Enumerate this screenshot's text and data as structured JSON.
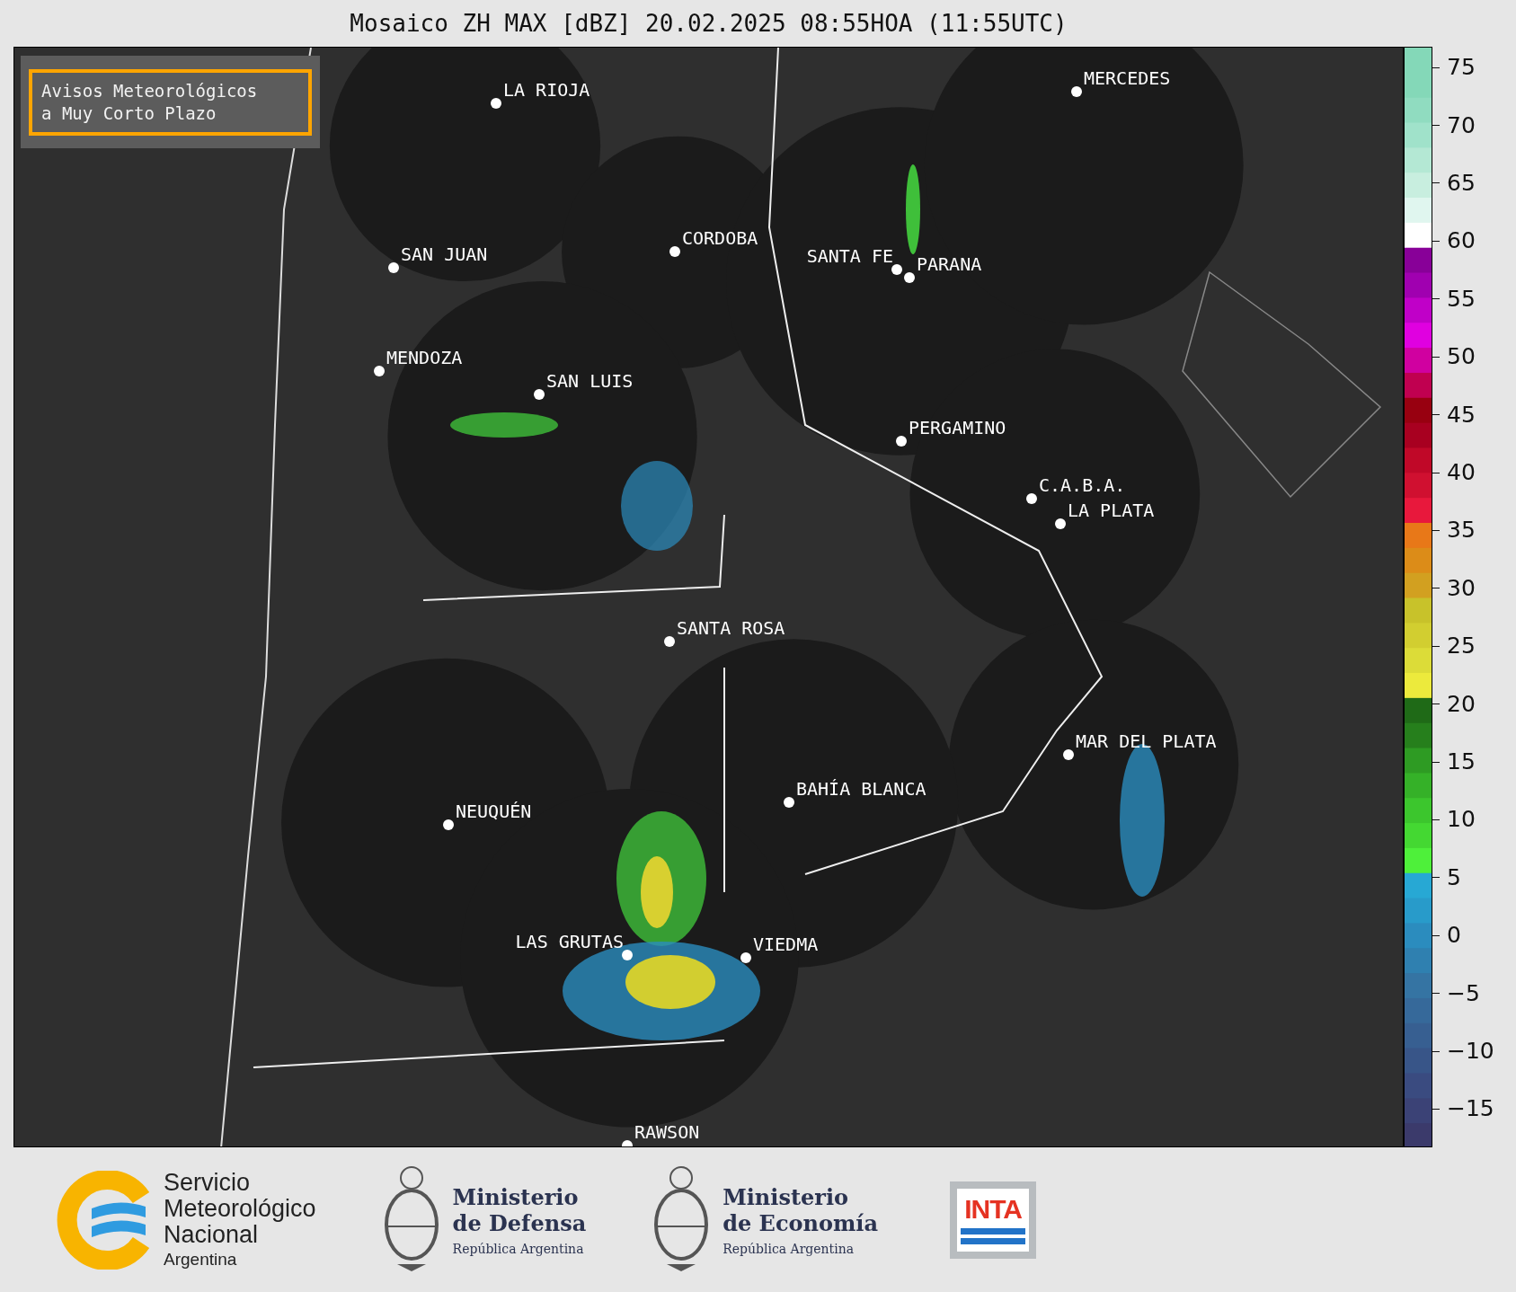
{
  "title": "Mosaico ZH MAX [dBZ] 20.02.2025 08:55HOA (11:55UTC)",
  "legend_box": {
    "lines": [
      "Avisos Meteorológicos",
      "a Muy Corto Plazo"
    ]
  },
  "cities": [
    {
      "name": "LA RIOJA"
    },
    {
      "name": "SAN JUAN"
    },
    {
      "name": "CORDOBA"
    },
    {
      "name": "SANTA FE"
    },
    {
      "name": "PARANA"
    },
    {
      "name": "MENDOZA"
    },
    {
      "name": "SAN LUIS"
    },
    {
      "name": "MERCEDES"
    },
    {
      "name": "PERGAMINO"
    },
    {
      "name": "C.A.B.A."
    },
    {
      "name": "LA PLATA"
    },
    {
      "name": "SANTA ROSA"
    },
    {
      "name": "MAR DEL PLATA"
    },
    {
      "name": "BAHÍA BLANCA"
    },
    {
      "name": "NEUQUÉN"
    },
    {
      "name": "LAS GRUTAS"
    },
    {
      "name": "VIEDMA"
    },
    {
      "name": "RAWSON"
    }
  ],
  "colorbar": {
    "ticks": [
      "75",
      "70",
      "65",
      "60",
      "55",
      "50",
      "45",
      "40",
      "35",
      "30",
      "25",
      "20",
      "15",
      "10",
      "5",
      "0",
      "−5",
      "−10",
      "−15"
    ]
  },
  "logos": [
    {
      "kind": "smn",
      "lines": [
        "Servicio",
        "Meteorológico",
        "Nacional",
        "Argentina"
      ]
    },
    {
      "kind": "ministry",
      "lines": [
        "Ministerio",
        "de Defensa",
        "República Argentina"
      ]
    },
    {
      "kind": "ministry",
      "lines": [
        "Ministerio",
        "de Economía",
        "República Argentina"
      ]
    },
    {
      "kind": "inta",
      "lines": [
        "INTA"
      ]
    }
  ]
}
